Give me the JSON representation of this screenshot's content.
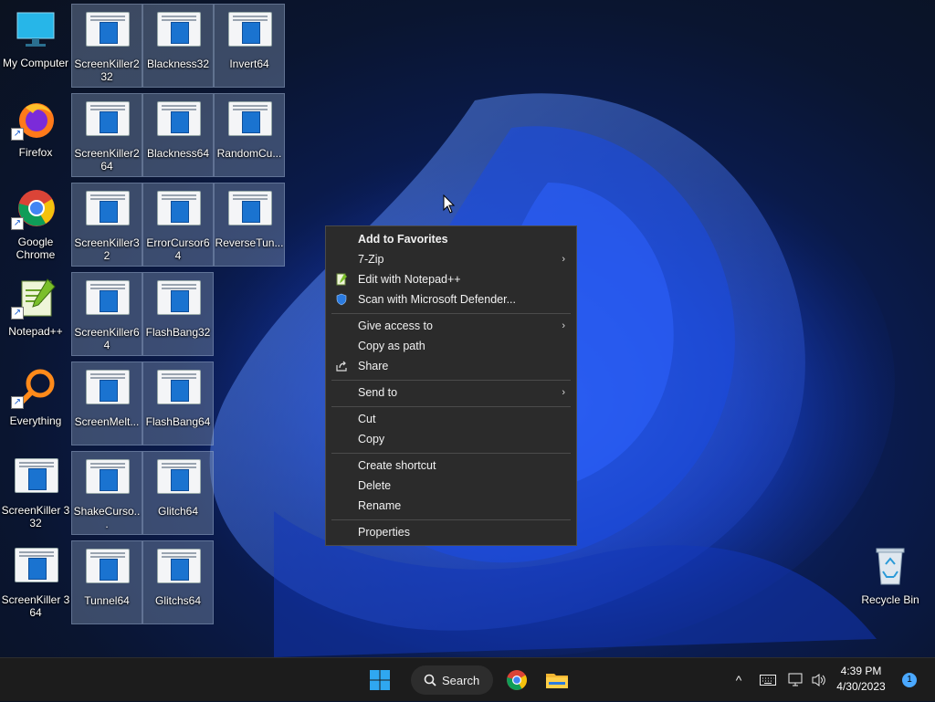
{
  "desktop": {
    "icons": {
      "my_computer": "My Computer",
      "firefox": "Firefox",
      "chrome": "Google Chrome",
      "notepadpp": "Notepad++",
      "everything": "Everything",
      "sk3_32": "ScreenKiller 3 32",
      "sk3_64": "ScreenKiller 3 64",
      "sk2_32": "ScreenKiller2 32",
      "sk2_64": "ScreenKiller2 64",
      "sk32": "ScreenKiller32",
      "sk64": "ScreenKiller64",
      "screenmelt": "ScreenMelt...",
      "shakecursor": "ShakeCurso...",
      "tunnel64": "Tunnel64",
      "blackness32": "Blackness32",
      "blackness64": "Blackness64",
      "errorcursor64": "ErrorCursor64",
      "flashbang32": "FlashBang32",
      "flashbang64": "FlashBang64",
      "glitch64": "Glitch64",
      "glitchs64": "Glitchs64",
      "invert64": "Invert64",
      "randomcu": "RandomCu...",
      "reversetun": "ReverseTun...",
      "recycle_bin": "Recycle Bin"
    }
  },
  "context_menu": {
    "items": [
      {
        "label": "Add to Favorites"
      },
      {
        "label": "7-Zip"
      },
      {
        "label": "Edit with Notepad++"
      },
      {
        "label": "Scan with Microsoft Defender..."
      },
      {
        "label": "Give access to"
      },
      {
        "label": "Copy as path"
      },
      {
        "label": "Share"
      },
      {
        "label": "Send to"
      },
      {
        "label": "Cut"
      },
      {
        "label": "Copy"
      },
      {
        "label": "Create shortcut"
      },
      {
        "label": "Delete"
      },
      {
        "label": "Rename"
      },
      {
        "label": "Properties"
      }
    ],
    "submenu_arrow": "›"
  },
  "taskbar": {
    "search_label": "Search",
    "time": "4:39 PM",
    "date": "4/30/2023",
    "notification_count": "1",
    "show_hidden_icons": "^"
  }
}
